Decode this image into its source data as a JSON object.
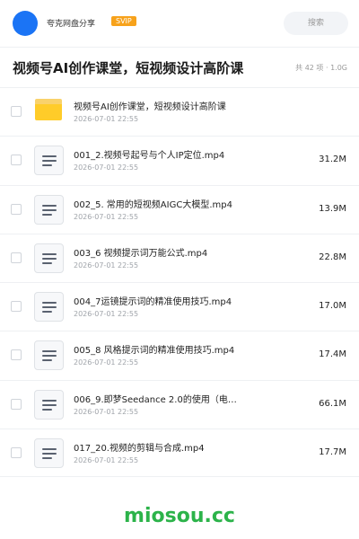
{
  "header": {
    "app_name": "夸克网盘分享",
    "vip_badge": "SVIP",
    "search_placeholder": "搜索",
    "avatar_color": "#1b74f5"
  },
  "title_bar": {
    "title": "视频号AI创作课堂，短视频设计高阶课",
    "meta": "共 42 项 · 1.0G"
  },
  "files": [
    {
      "type": "folder",
      "name": "视频号AI创作课堂，短视频设计高阶课",
      "date": "2026-07-01 22:55",
      "size": ""
    },
    {
      "type": "file",
      "name": "001_2.视频号起号与个人IP定位.mp4",
      "date": "2026-07-01 22:55",
      "size": "31.2M"
    },
    {
      "type": "file",
      "name": "002_5. 常用的短视频AIGC大模型.mp4",
      "date": "2026-07-01 22:55",
      "size": "13.9M"
    },
    {
      "type": "file",
      "name": "003_6 视频提示词万能公式.mp4",
      "date": "2026-07-01 22:55",
      "size": "22.8M"
    },
    {
      "type": "file",
      "name": "004_7运镜提示词的精准使用技巧.mp4",
      "date": "2026-07-01 22:55",
      "size": "17.0M"
    },
    {
      "type": "file",
      "name": "005_8 风格提示词的精准使用技巧.mp4",
      "date": "2026-07-01 22:55",
      "size": "17.4M"
    },
    {
      "type": "file",
      "name": "006_9.即梦Seedance 2.0的使用（电…",
      "date": "2026-07-01 22:55",
      "size": "66.1M"
    },
    {
      "type": "file",
      "name": "017_20.视频的剪辑与合成.mp4",
      "date": "2026-07-01 22:55",
      "size": "17.7M"
    }
  ],
  "watermark": "miosou.cc",
  "colors": {
    "vip": "#f7a21b",
    "folder": "#ffcc29",
    "watermark": "#2cb34a"
  }
}
